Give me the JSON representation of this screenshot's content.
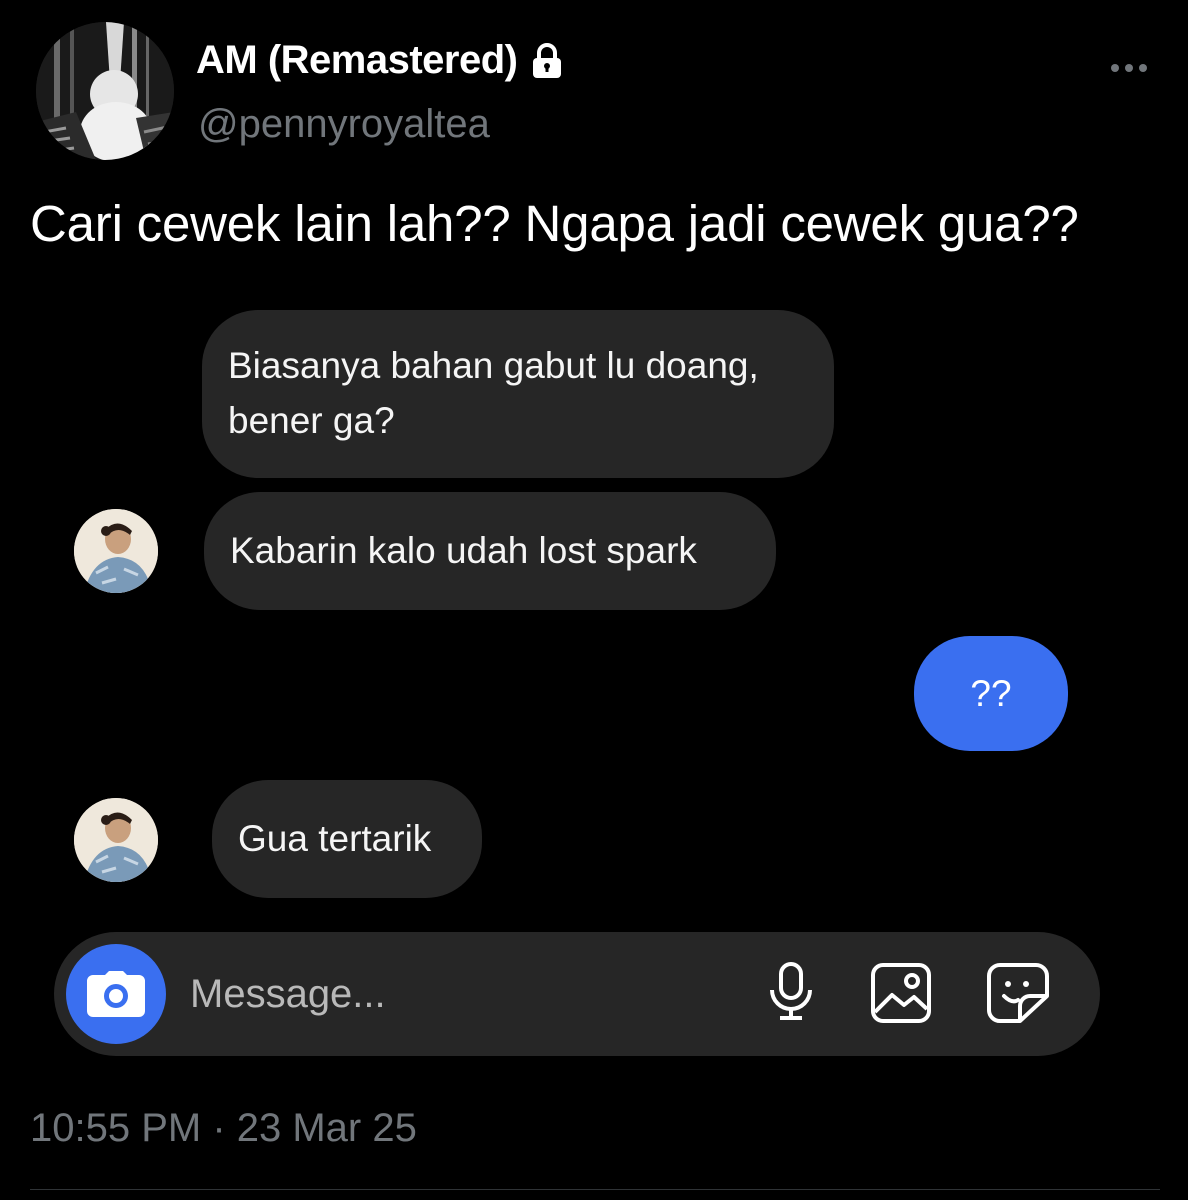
{
  "tweet": {
    "display_name": "AM (Remastered)",
    "handle": "@pennyroyaltea",
    "protected_icon": "lock-icon",
    "more_icon": "more-horizontal-icon",
    "text": "Cari cewek lain lah?? Ngapa jadi cewek gua??",
    "timestamp": "10:55 PM · 23 Mar 25"
  },
  "dm_screenshot": {
    "messages": [
      {
        "sender": "them",
        "lines": [
          "Biasanya bahan gabut lu doang,",
          "bener ga?"
        ]
      },
      {
        "sender": "them",
        "text": "Kabarin kalo udah lost spark"
      },
      {
        "sender": "me",
        "text": "??"
      },
      {
        "sender": "them",
        "text": "Gua tertarik"
      }
    ],
    "composer": {
      "placeholder": "Message...",
      "icons": [
        "camera-icon",
        "microphone-icon",
        "gallery-icon",
        "sticker-icon"
      ]
    }
  },
  "colors": {
    "background": "#000000",
    "bubble_incoming": "#262626",
    "bubble_outgoing": "#3a6ff0",
    "secondary_text": "#71767b"
  }
}
